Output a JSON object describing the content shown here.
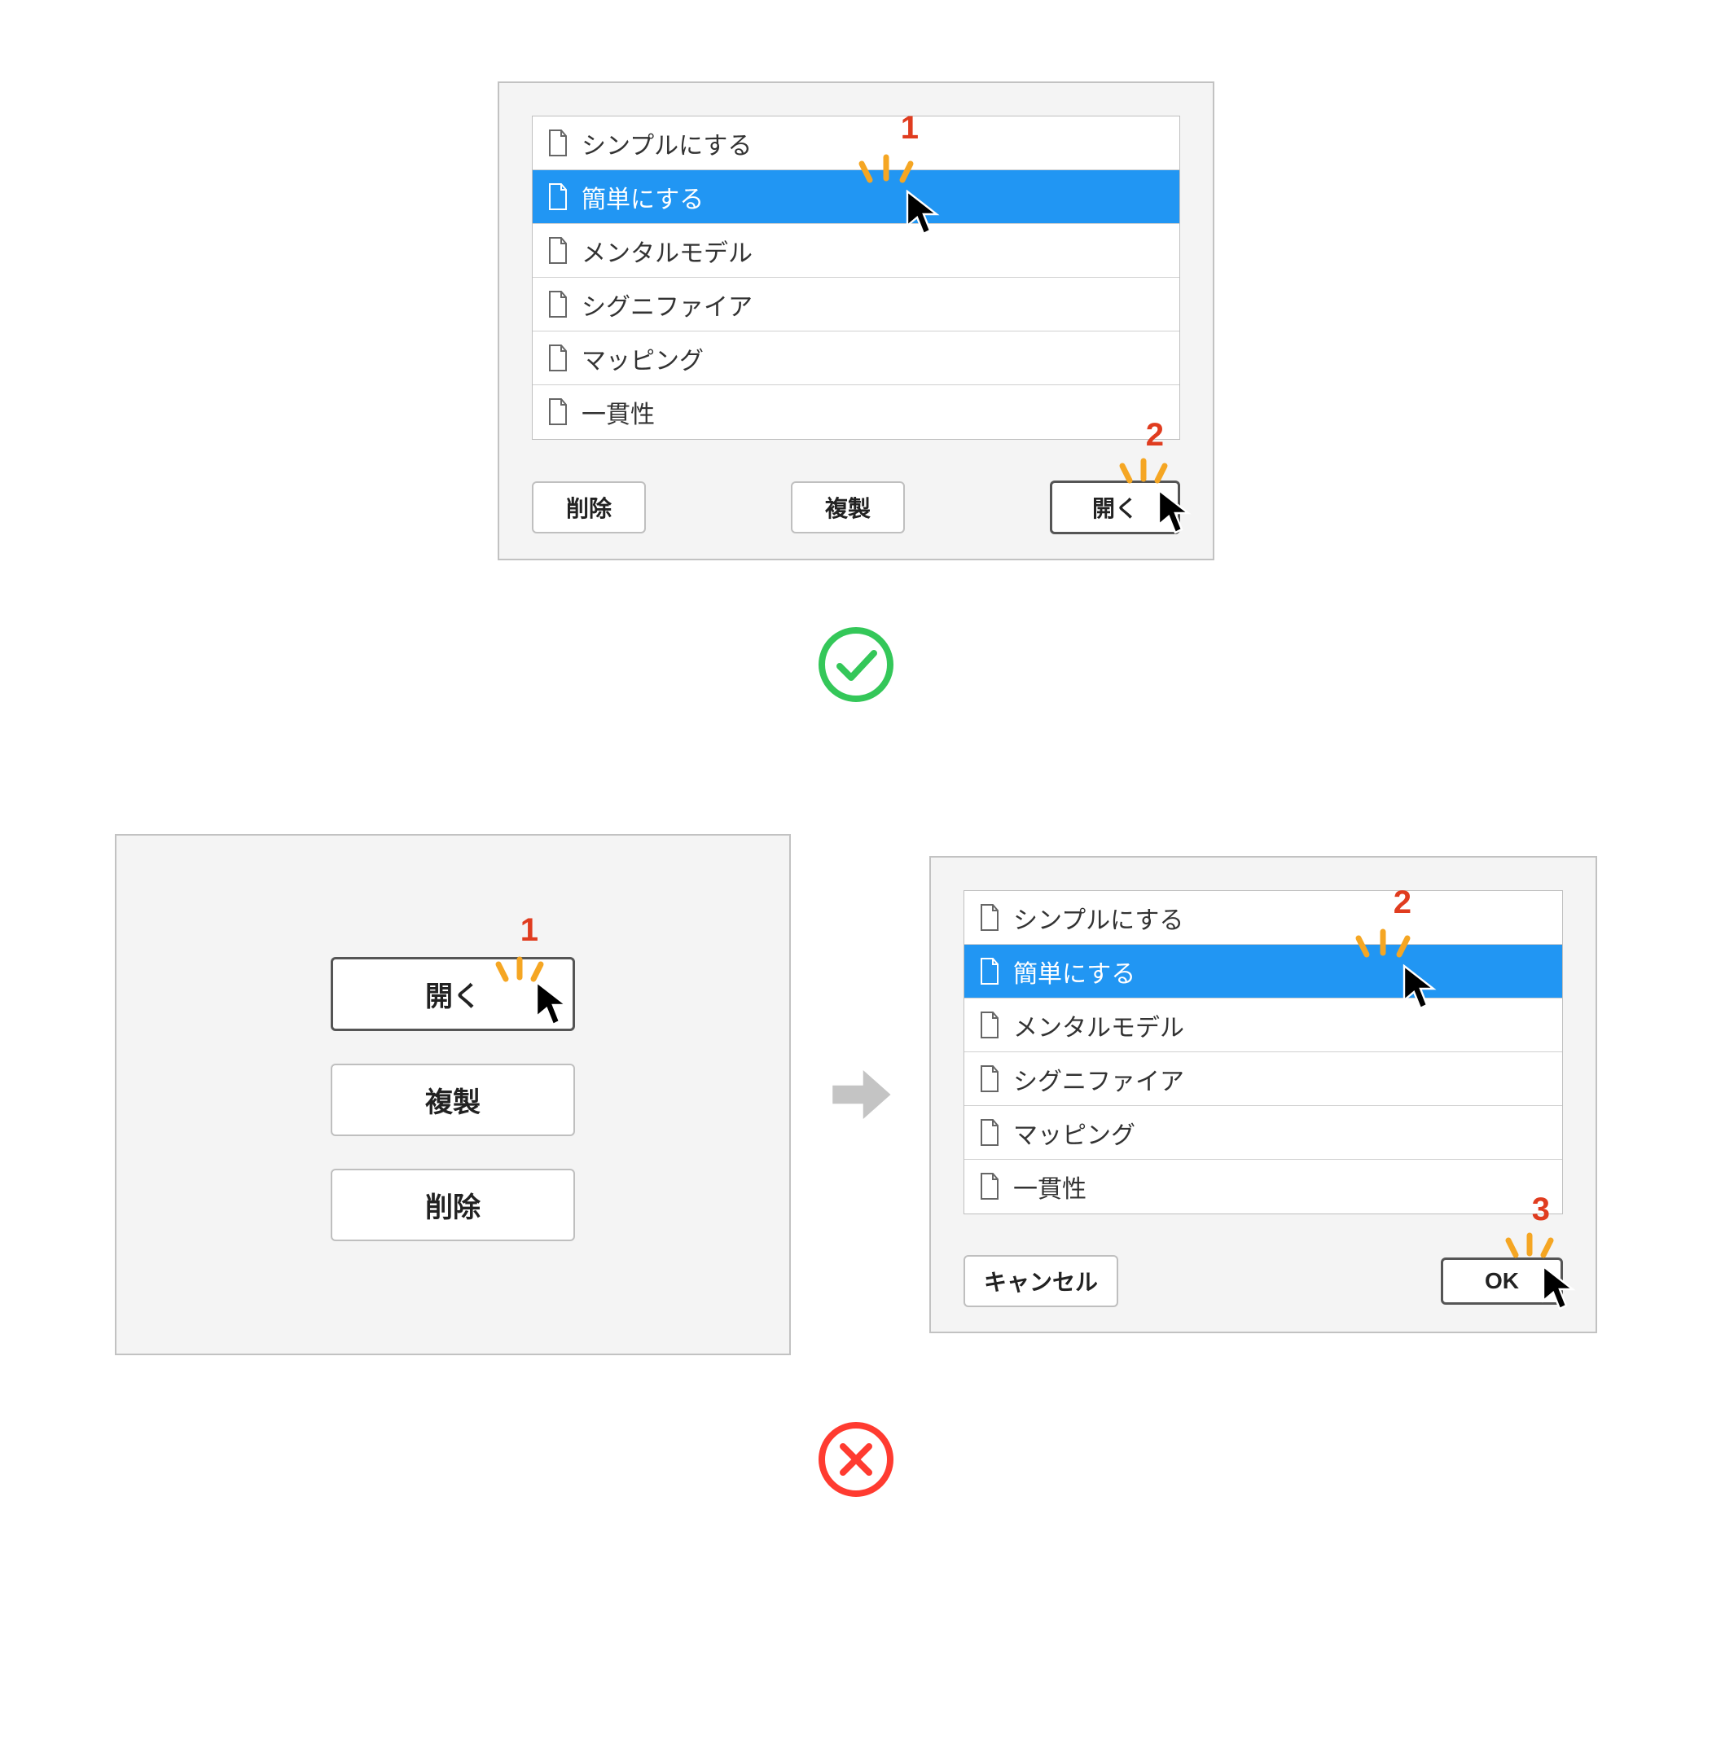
{
  "good": {
    "list": {
      "items": [
        {
          "label": "シンプルにする"
        },
        {
          "label": "簡単にする"
        },
        {
          "label": "メンタルモデル"
        },
        {
          "label": "シグニファイア"
        },
        {
          "label": "マッピング"
        },
        {
          "label": "一貫性"
        }
      ],
      "selected_index": 1
    },
    "buttons": {
      "delete": "削除",
      "duplicate": "複製",
      "open": "開く"
    },
    "clicks": {
      "step1": "1",
      "step2": "2"
    }
  },
  "bad": {
    "left_buttons": {
      "open": "開く",
      "duplicate": "複製",
      "delete": "削除"
    },
    "right": {
      "list": {
        "items": [
          {
            "label": "シンプルにする"
          },
          {
            "label": "簡単にする"
          },
          {
            "label": "メンタルモデル"
          },
          {
            "label": "シグニファイア"
          },
          {
            "label": "マッピング"
          },
          {
            "label": "一貫性"
          }
        ],
        "selected_index": 1
      },
      "buttons": {
        "cancel": "キャンセル",
        "ok": "OK"
      }
    },
    "clicks": {
      "step1": "1",
      "step2": "2",
      "step3": "3"
    }
  },
  "status": {
    "good_color": "#34c759",
    "bad_color": "#ff3b30"
  }
}
